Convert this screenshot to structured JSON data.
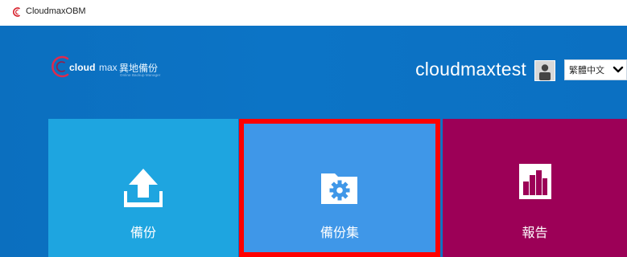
{
  "window": {
    "title": "CloudmaxOBM",
    "icon": "cloudmax-logo-icon"
  },
  "header": {
    "logo": {
      "brand": "cloudmax",
      "brand_bold": "cloud",
      "brand_light": "max",
      "cjk": "異地備份",
      "subtitle": "Online Backup Manager"
    },
    "username": "cloudmaxtest",
    "avatar_icon": "user-avatar-icon",
    "language": {
      "selected": "繁體中文",
      "chevron_icon": "chevron-down-icon"
    }
  },
  "tiles": [
    {
      "label": "備份",
      "icon": "upload-icon",
      "color": "#1ea5e0"
    },
    {
      "label": "備份集",
      "icon": "folder-gear-icon",
      "color": "#3f97e8",
      "highlight_color": "#ff0000"
    },
    {
      "label": "報告",
      "icon": "report-chart-icon",
      "color": "#9c0057"
    }
  ]
}
